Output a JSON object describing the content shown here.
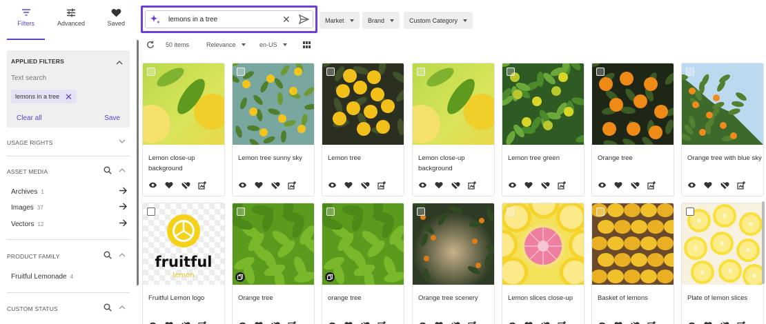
{
  "sidebar": {
    "tabs": [
      {
        "label": "Filters",
        "icon": "filter-icon",
        "active": true
      },
      {
        "label": "Advanced",
        "icon": "sliders-icon",
        "active": false
      },
      {
        "label": "Saved",
        "icon": "heart-icon",
        "active": false
      }
    ],
    "applied": {
      "title": "APPLIED FILTERS",
      "text_search_label": "Text search",
      "chip": "lemons in a tree",
      "clear": "Clear all",
      "save": "Save"
    },
    "usage_rights": "USAGE RIGHTS",
    "asset_media": {
      "title": "ASSET MEDIA",
      "items": [
        {
          "label": "Archives",
          "count": "1"
        },
        {
          "label": "Images",
          "count": "37"
        },
        {
          "label": "Vectors",
          "count": "12"
        }
      ]
    },
    "product_family": {
      "title": "PRODUCT FAMILY",
      "items": [
        {
          "label": "Fruitful Lemonade",
          "count": "4"
        }
      ]
    },
    "custom_status": "CUSTOM STATUS"
  },
  "search": {
    "query": "lemons in a tree"
  },
  "filters": {
    "market": "Market",
    "brand": "Brand",
    "custom_category": "Custom Category"
  },
  "toolbar": {
    "count": "50 items",
    "sort": "Relevance",
    "locale": "en-US"
  },
  "colors": {
    "accent": "#5b43c7",
    "highlight": "#6b3fd8"
  },
  "cards": [
    {
      "title": "Lemon close-up background",
      "scene": "closeup"
    },
    {
      "title": "Lemon tree sunny sky",
      "scene": "sky"
    },
    {
      "title": "Lemon tree",
      "scene": "dark"
    },
    {
      "title": "Lemon close-up background",
      "scene": "closeup"
    },
    {
      "title": "Lemon tree green",
      "scene": "green"
    },
    {
      "title": "Orange tree",
      "scene": "orange"
    },
    {
      "title": "Orange tree with blue sky",
      "scene": "bluesky"
    },
    {
      "title": "Fruitful Lemon logo",
      "scene": "logo",
      "logo_word": "fruitful",
      "logo_sub": "lemon"
    },
    {
      "title": "Orange tree",
      "scene": "leaves"
    },
    {
      "title": "orange tree",
      "scene": "leaves"
    },
    {
      "title": "Orange tree scenery",
      "scene": "scenery"
    },
    {
      "title": "Lemon slices close-up",
      "scene": "slices"
    },
    {
      "title": "Basket of lemons",
      "scene": "basket"
    },
    {
      "title": "Plate of lemon slices",
      "scene": "plate"
    }
  ]
}
